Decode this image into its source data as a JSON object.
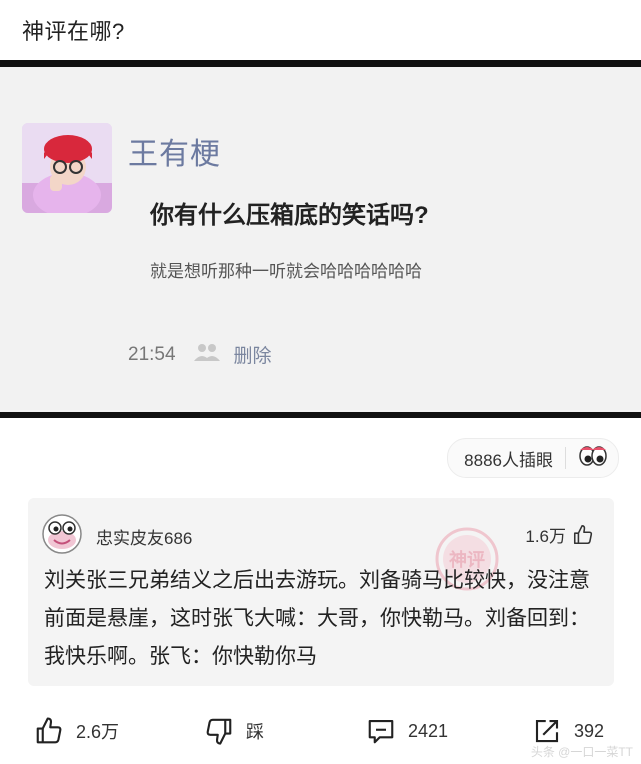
{
  "header": {
    "title": "神评在哪?"
  },
  "post": {
    "author": "王有梗",
    "title": "你有什么压箱底的笑话吗?",
    "description": "就是想听那种一听就会哈哈哈哈哈哈",
    "time": "21:54",
    "delete_label": "删除"
  },
  "views": {
    "label": "8886人插眼"
  },
  "comment": {
    "username": "忠实皮友686",
    "likes": "1.6万",
    "stamp_text": "神评",
    "text": "刘关张三兄弟结义之后出去游玩。刘备骑马比较快，没注意前面是悬崖，这时张飞大喊：大哥，你快勒马。刘备回到：我快乐啊。张飞：你快勒你马"
  },
  "actions": {
    "like_count": "2.6万",
    "dislike_label": "踩",
    "comment_count": "2421",
    "share_count": "392"
  },
  "watermark": "头条 @一口一菜TT",
  "colors": {
    "bar": "#111111",
    "post_bg": "#f2f2f2",
    "author_name": "#6c7aa0",
    "comment_bg": "#f4f4f4",
    "stamp": "#e8738a"
  },
  "icons": [
    "thumbs-up-icon",
    "thumbs-down-icon",
    "comment-icon",
    "share-icon",
    "friends-icon",
    "eyes-icon"
  ]
}
